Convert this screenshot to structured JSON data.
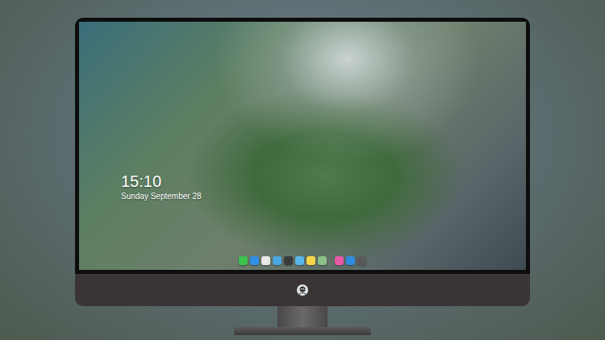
{
  "clock": {
    "time": "15:10",
    "date": "Sunday September 28"
  },
  "dock": {
    "pinned": [
      {
        "color": "#3cc24f"
      },
      {
        "color": "#2f8fe6"
      },
      {
        "color": "#e9e9e9"
      },
      {
        "color": "#4aa6e0"
      },
      {
        "color": "#3b3b3b"
      },
      {
        "color": "#59b7ea"
      },
      {
        "color": "#f5d547"
      },
      {
        "color": "#8cc08a"
      }
    ],
    "extra": [
      {
        "color": "#e65aa6"
      },
      {
        "color": "#2f8de0"
      },
      {
        "color": "#5a5a5a"
      }
    ]
  }
}
